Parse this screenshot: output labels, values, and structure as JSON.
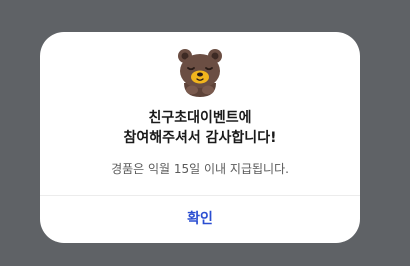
{
  "dialog": {
    "illustration": "bear-bowing-icon",
    "title_line1": "친구초대이벤트에",
    "title_line2": "참여해주셔서 감사합니다!",
    "description": "경품은 익월 15일 이내 지급됩니다.",
    "confirm_label": "확인"
  },
  "colors": {
    "overlay": "#5f6266",
    "confirm_text": "#2b4ed1",
    "bear_fur": "#6b4e43",
    "bear_muzzle": "#f2b51d"
  }
}
